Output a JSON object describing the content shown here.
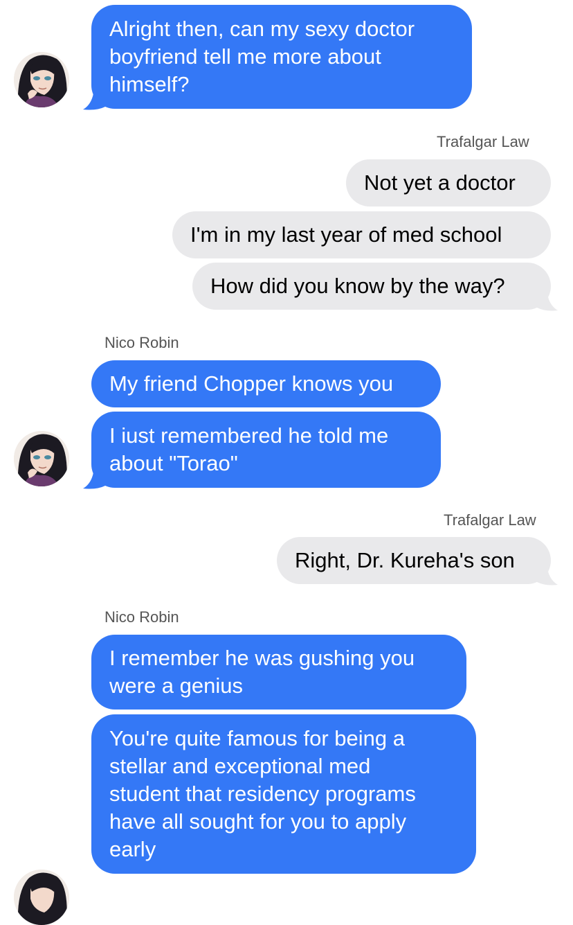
{
  "thread": {
    "participants": {
      "left": "Nico Robin",
      "right": "Trafalgar Law"
    },
    "groups": [
      {
        "side": "left",
        "sender": "",
        "messages": [
          {
            "lines": [
              "Alright then, can my sexy doctor",
              "boyfriend tell me more about",
              "himself?"
            ]
          }
        ]
      },
      {
        "side": "right",
        "sender": "Trafalgar Law",
        "messages": [
          {
            "lines": [
              "Not yet a doctor"
            ]
          },
          {
            "lines": [
              "I'm in my last year of med school"
            ]
          },
          {
            "lines": [
              "How did you know by the way?"
            ]
          }
        ]
      },
      {
        "side": "left",
        "sender": "Nico Robin",
        "messages": [
          {
            "lines": [
              "My friend Chopper knows you"
            ]
          },
          {
            "lines": [
              "I iust remembered he told me",
              "about \"Torao\""
            ]
          }
        ]
      },
      {
        "side": "right",
        "sender": "Trafalgar Law",
        "messages": [
          {
            "lines": [
              "Right, Dr. Kureha's son"
            ]
          }
        ]
      },
      {
        "side": "left",
        "sender": "Nico Robin",
        "messages": [
          {
            "lines": [
              "I remember he was gushing you",
              "were a genius"
            ]
          },
          {
            "lines": [
              "You're quite famous for being a",
              "stellar and exceptional med",
              "student that residency programs",
              "have all sought for you to apply",
              "early"
            ]
          }
        ]
      }
    ]
  },
  "colors": {
    "outgoing_bubble": "#3478f6",
    "incoming_bubble": "#e9e9eb",
    "background": "#ffffff",
    "sender_label": "#555555"
  },
  "icons": {
    "avatar": "nico-robin-avatar-icon"
  }
}
